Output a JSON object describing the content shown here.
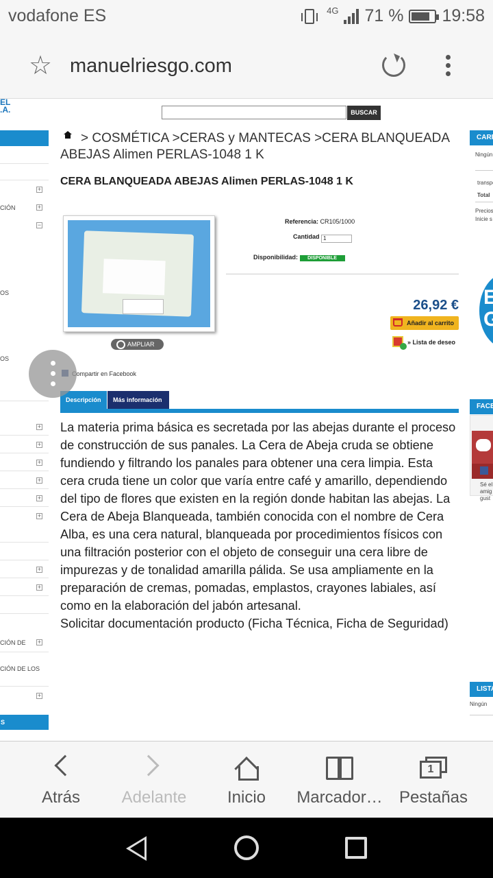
{
  "status": {
    "carrier": "vodafone ES",
    "network": "4G",
    "battery_pct": "71 %",
    "time": "19:58"
  },
  "browser": {
    "url": "manuelriesgo.com",
    "nav": {
      "back": "Atrás",
      "forward": "Adelante",
      "home": "Inicio",
      "bookmarks": "Marcador…",
      "tabs": "Pestañas",
      "tab_count": "1"
    }
  },
  "site": {
    "logo_fragment_1": "EL",
    "logo_fragment_2": ".A.",
    "search_button": "BUSCAR"
  },
  "left_sidebar": {
    "cut_labels": [
      "CIÓN",
      "OS",
      "OS",
      "CIÓN DE",
      "CIÓN DE LOS"
    ],
    "footer": "S",
    "expander_plus": "+",
    "expander_minus": "−"
  },
  "right_sidebar": {
    "cart_head": "CARRITO",
    "cart_empty": "Ningún",
    "trans": "transporte",
    "total": "Total",
    "precio": "Precios",
    "inicie": "Inicie s",
    "fb_head": "FACEBOOK",
    "fb_text_1": "Sé el",
    "fb_text_2": "amig",
    "fb_text_3": "gust",
    "badge_1": "E",
    "badge_2": "G",
    "list_head": "LISTA",
    "list_empty": "Ningún"
  },
  "breadcrumb": {
    "sep": ">",
    "items": [
      "COSMÉTICA",
      "CERAS y MANTECAS",
      "CERA BLANQUEADA ABEJAS Alimen PERLAS-1048 1 K"
    ]
  },
  "product": {
    "title": "CERA BLANQUEADA ABEJAS Alimen PERLAS-1048 1 K",
    "ampliar": "AMPLIAR",
    "fb_share": "Compartir en Facebook",
    "ref_label": "Referencia:",
    "ref_value": "CR105/1000",
    "qty_label": "Cantidad",
    "qty_value": "1",
    "avail_label": "Disponibilidad:",
    "avail_value": "DISPONIBLE",
    "price": "26,92 €",
    "add_to_cart": "Añadir al carrito",
    "wishlist": "» Lista de deseo"
  },
  "tabs": [
    "Descripción",
    "Más información"
  ],
  "description": {
    "p1": "La materia prima básica es secretada por las abejas durante el proceso de construcción de sus panales. La Cera de Abeja cruda se obtiene fundiendo y filtrando los panales para obtener una cera limpia. Esta cera cruda tiene un color que varía entre café y amarillo, dependiendo del tipo de flores que existen en la región donde habitan las abejas. La Cera de Abeja Blanqueada, también conocida con el nombre de Cera Alba, es una cera natural, blanqueada por procedimientos físicos con una filtración posterior con el objeto de conseguir una cera libre de impurezas y de tonalidad amarilla pálida. Se usa ampliamente en la preparación de cremas, pomadas, emplastos, crayones labiales, así como en la elaboración del jabón artesanal.",
    "p2": "Solicitar documentación producto (Ficha Técnica, Ficha de Seguridad)"
  },
  "colors": {
    "accent_blue": "#1a8ccd",
    "dark_blue_tab": "#1b2f6e",
    "available_green": "#1e9e37",
    "cart_orange": "#f0b41f",
    "price_blue": "#1b4f8a"
  }
}
